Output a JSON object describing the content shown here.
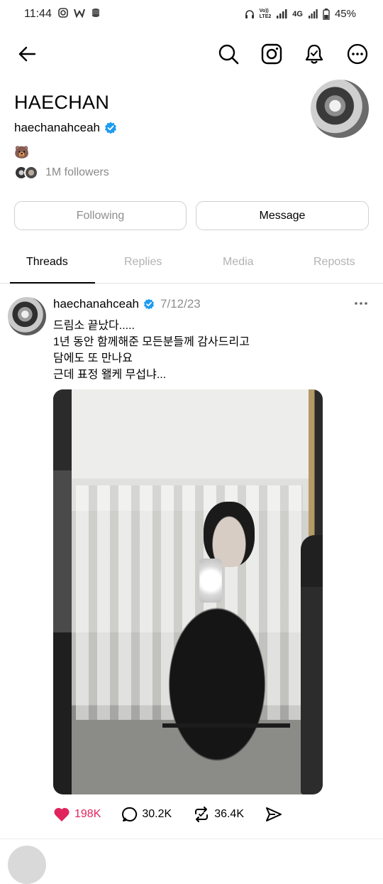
{
  "status_bar": {
    "time": "11:44",
    "network_top": "Vo))",
    "network_bottom": "LTE2",
    "signal_label": "4G",
    "battery": "45%"
  },
  "toolbar": {
    "back": "back-arrow-icon",
    "search": "search-icon",
    "instagram": "instagram-icon",
    "notifications": "bell-icon",
    "more": "more-icon"
  },
  "profile": {
    "name": "HAECHAN",
    "handle": "haechanahceah",
    "bio": "🐻",
    "followers": "1M followers"
  },
  "buttons": {
    "following": "Following",
    "message": "Message"
  },
  "tabs": [
    {
      "label": "Threads",
      "active": true
    },
    {
      "label": "Replies",
      "active": false
    },
    {
      "label": "Media",
      "active": false
    },
    {
      "label": "Reposts",
      "active": false
    }
  ],
  "post": {
    "author": "haechanahceah",
    "date": "7/12/23",
    "lines": [
      "드림소 끝났다.....",
      "1년 동안 함께해준 모든분들께 감사드리고",
      "담에도 또 만나요",
      "근데 표정 왤케 무섭냐..."
    ],
    "likes": "198K",
    "comments": "30.2K",
    "reposts": "36.4K"
  },
  "colors": {
    "verified": "#1d9bf0",
    "like": "#e0245e",
    "muted": "#8e8e8e",
    "border": "#d0d0d0"
  }
}
